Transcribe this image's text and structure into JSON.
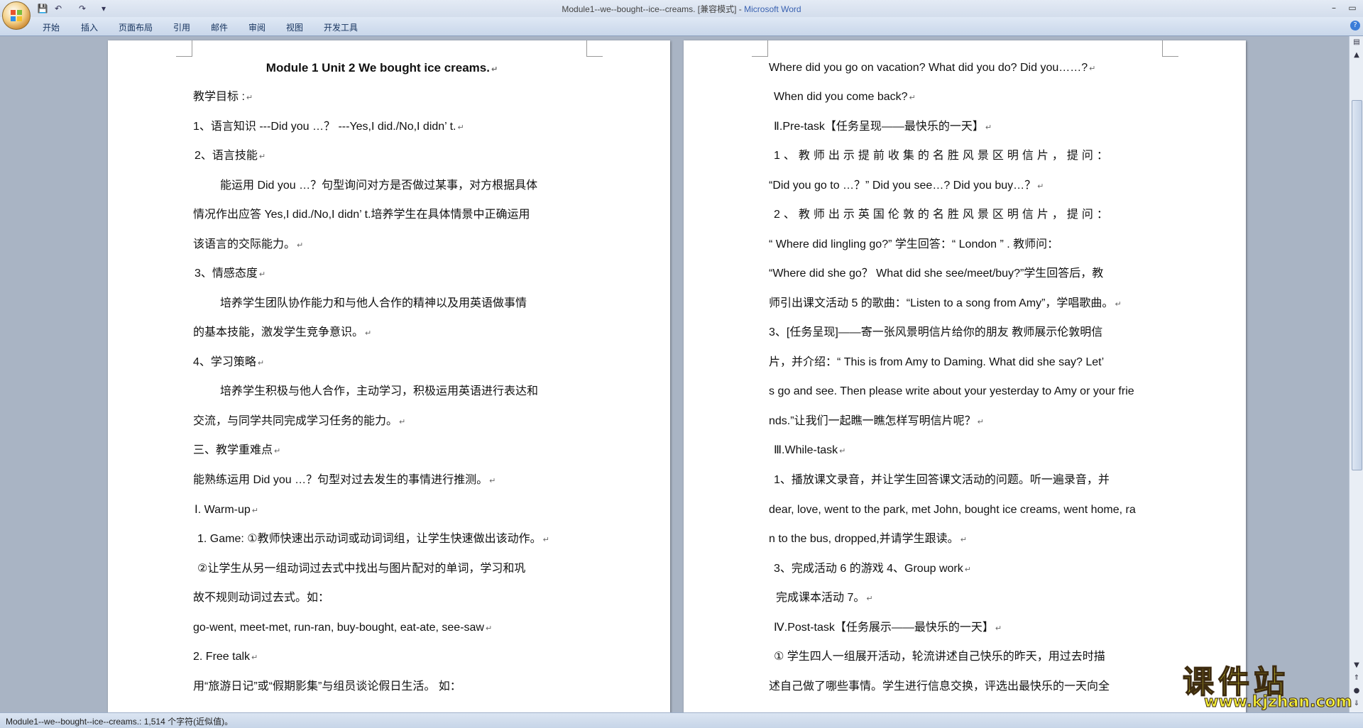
{
  "window": {
    "title_doc": "Module1--we--bought--ice--creams. [兼容模式] - ",
    "title_app": "Microsoft Word"
  },
  "ribbon": {
    "tabs": [
      "开始",
      "插入",
      "页面布局",
      "引用",
      "邮件",
      "审阅",
      "视图",
      "开发工具"
    ]
  },
  "left_page": {
    "lines": [
      "Module 1 Unit 2  We bought ice creams.",
      "教学目标 :",
      "1、语言知识 ---Did you …？  ---Yes,I did./No,I didn’ t.",
      "2、语言技能",
      "能运用 Did you …？句型询问对方是否做过某事，对方根据具体",
      "情况作出应答 Yes,I did./No,I didn’ t.培养学生在具体情景中正确运用",
      "该语言的交际能力。",
      "3、情感态度",
      "培养学生团队协作能力和与他人合作的精神以及用英语做事情",
      "的基本技能，激发学生竞争意识。",
      "4、学习策略",
      "培养学生积极与他人合作，主动学习，积极运用英语进行表达和",
      "交流，与同学共同完成学习任务的能力。",
      "三、教学重难点",
      "能熟练运用 Did you …？句型对过去发生的事情进行推测。",
      "Ⅰ. Warm-up",
      "1. Game: ①教师快速出示动词或动词词组，让学生快速做出该动作。",
      "②让学生从另一组动词过去式中找出与图片配对的单词，学习和巩",
      "故不规则动词过去式。如：",
      "go-went, meet-met, run-ran, buy-bought, eat-ate, see-saw",
      "2. Free talk",
      "用“旅游日记”或“假期影集”与组员谈论假日生活。    如："
    ]
  },
  "right_page": {
    "lines": [
      "Where did you go on vacation?   What did you do?   Did you……?",
      "When did you come back?",
      "Ⅱ.Pre-task【任务呈现——最快乐的一天】",
      "1、教师出示提前收集的名胜风景区明信片，提问：",
      "“Did you go to …？”  Did you see…? Did you buy…？",
      "2、教师出示英国伦敦的名胜风景区明信片，提问：",
      "“ Where did lingling go?” 学生回答：“ London ” . 教师问：",
      "“Where did she go？  What did she see/meet/buy?”学生回答后，教",
      "师引出课文活动 5 的歌曲：“Listen to a song from Amy”，学唱歌曲。",
      "3、[任务呈现]——寄一张风景明信片给你的朋友  教师展示伦敦明信",
      "片，并介绍：“ This is from Amy to Daming. What did she say? Let’",
      "s go and see. Then please write about your yesterday to Amy or your frie",
      "nds.”让我们一起瞧一瞧怎样写明信片呢？",
      "Ⅲ.While-task",
      "1、播放课文录音，并让学生回答课文活动的问题。听一遍录音，并",
      "dear, love, went to the park, met John, bought ice creams, went home, ra",
      "n to the bus, dropped,并请学生跟读。",
      "3、完成活动 6 的游戏  4、Group work",
      "完成课本活动 7。",
      "Ⅳ.Post-task【任务展示——最快乐的一天】",
      "① 学生四人一组展开活动，轮流讲述自己快乐的昨天，用过去时描",
      "述自己做了哪些事情。学生进行信息交换，评选出最快乐的一天向全"
    ]
  },
  "status": {
    "text": "Module1--we--bought--ice--creams.: 1,514 个字符(近似值)。"
  },
  "watermark": {
    "main": "课件站",
    "url": "www.kjzhan.com"
  }
}
